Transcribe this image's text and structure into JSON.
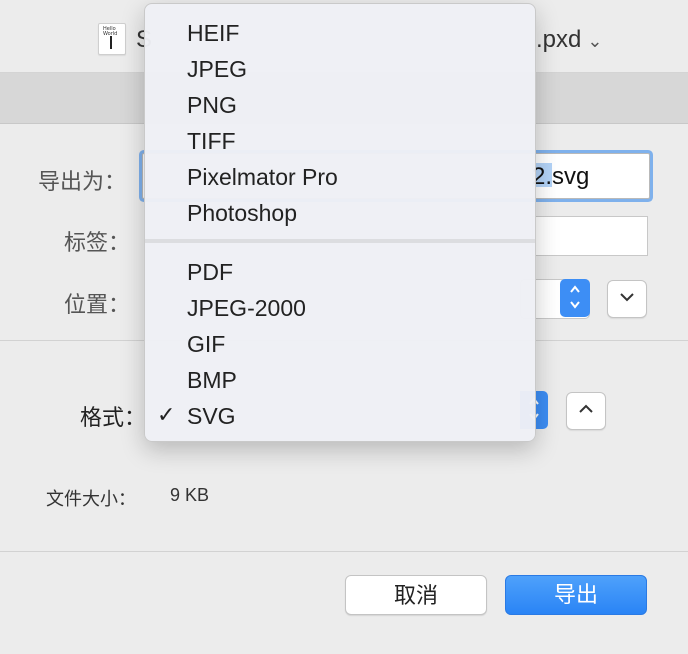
{
  "window": {
    "title_left": "S",
    "title_right": ".pxd",
    "title_chevron": "⌄",
    "doc_icon_text": "Hello\nWorld"
  },
  "form": {
    "export_as_label": "导出为：",
    "filename_selected": "2",
    "filename_suffix": ".svg",
    "tags_label": "标签：",
    "location_label": "位置：",
    "format_label": "格式：",
    "stepper_symbol": "⌃⌄"
  },
  "format_menu": {
    "items": [
      {
        "label": "HEIF",
        "checked": false
      },
      {
        "label": "JPEG",
        "checked": false
      },
      {
        "label": "PNG",
        "checked": false
      },
      {
        "label": "TIFF",
        "checked": false
      },
      {
        "label": "Pixelmator Pro",
        "checked": false
      },
      {
        "label": "Photoshop",
        "checked": false
      },
      {
        "label": "PDF",
        "checked": false
      },
      {
        "label": "JPEG-2000",
        "checked": false
      },
      {
        "label": "GIF",
        "checked": false
      },
      {
        "label": "BMP",
        "checked": false
      },
      {
        "label": "SVG",
        "checked": true
      }
    ],
    "check_mark": "✓"
  },
  "file_size": {
    "label": "文件大小：",
    "value": "9 KB"
  },
  "buttons": {
    "cancel": "取消",
    "export": "导出"
  },
  "colors": {
    "accent": "#2a84f5",
    "focus_ring": "#7fb1ec",
    "selection": "#b3d3f7"
  }
}
